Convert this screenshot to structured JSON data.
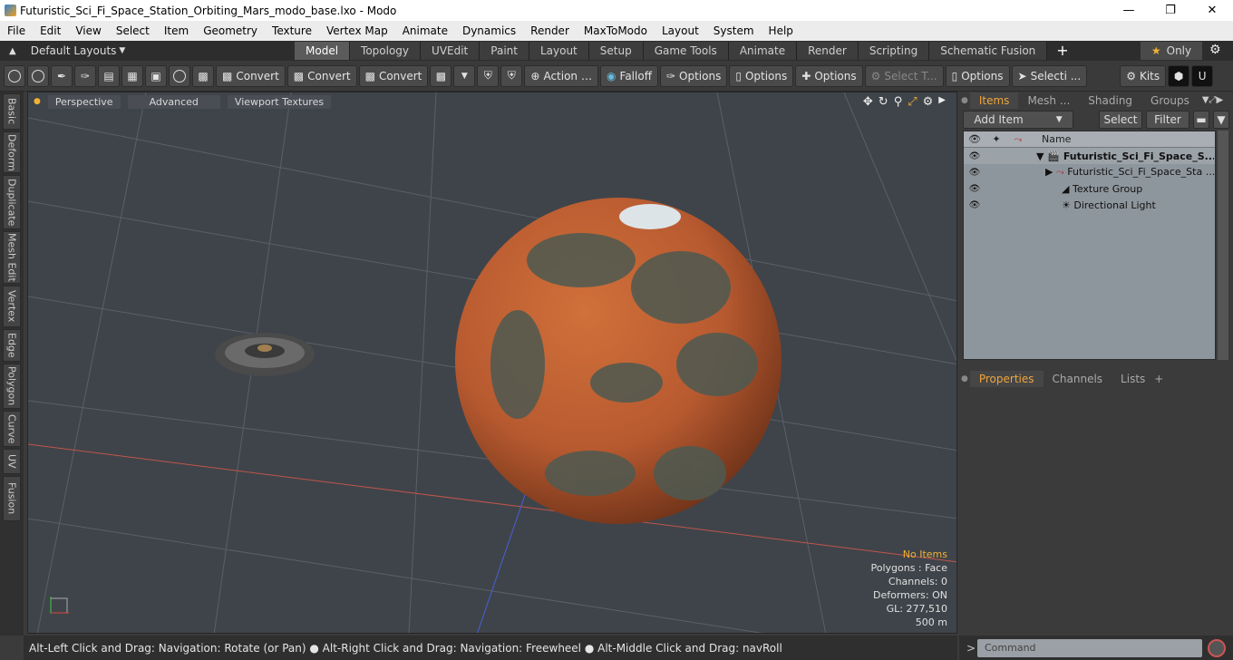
{
  "window": {
    "title": "Futuristic_Sci_Fi_Space_Station_Orbiting_Mars_modo_base.lxo - Modo"
  },
  "menu": [
    "File",
    "Edit",
    "View",
    "Select",
    "Item",
    "Geometry",
    "Texture",
    "Vertex Map",
    "Animate",
    "Dynamics",
    "Render",
    "MaxToModo",
    "Layout",
    "System",
    "Help"
  ],
  "layouts": {
    "label": "Default Layouts"
  },
  "tabs": [
    "Model",
    "Topology",
    "UVEdit",
    "Paint",
    "Layout",
    "Setup",
    "Game Tools",
    "Animate",
    "Render",
    "Scripting",
    "Schematic Fusion"
  ],
  "only_label": "Only",
  "toolbar": {
    "convert1": "Convert",
    "convert2": "Convert",
    "convert3": "Convert",
    "action": "Action",
    "falloff": "Falloff",
    "options1": "Options",
    "options2": "Options",
    "options3": "Options",
    "options4": "Options",
    "select_t": "Select T...",
    "selecti": "Selecti ...",
    "kits": "Kits"
  },
  "left_tabs": [
    "Basic",
    "Deform",
    "Duplicate",
    "Mesh Edit",
    "Vertex",
    "Edge",
    "Polygon",
    "Curve",
    "UV",
    "Fusion"
  ],
  "viewport": {
    "buttons": [
      "Perspective",
      "Advanced",
      "Viewport Textures"
    ],
    "info": {
      "no_items": "No Items",
      "polygons": "Polygons : Face",
      "channels": "Channels: 0",
      "deformers": "Deformers: ON",
      "gl": "GL: 277,510",
      "scale": "500 m"
    }
  },
  "right_panel": {
    "top_tabs": [
      "Items",
      "Mesh ...",
      "Shading",
      "Groups"
    ],
    "add_item": "Add Item",
    "select": "Select",
    "filter": "Filter",
    "col_name": "Name",
    "items": [
      {
        "name": "Futuristic_Sci_Fi_Space_S...",
        "indent": 0
      },
      {
        "name": "Futuristic_Sci_Fi_Space_Sta ...",
        "indent": 1
      },
      {
        "name": "Texture Group",
        "indent": 1
      },
      {
        "name": "Directional Light",
        "indent": 1
      }
    ],
    "bottom_tabs": [
      "Properties",
      "Channels",
      "Lists"
    ]
  },
  "status": {
    "text": "Alt-Left Click and Drag: Navigation: Rotate (or Pan) ● Alt-Right Click and Drag: Navigation: Freewheel ● Alt-Middle Click and Drag: navRoll"
  },
  "command": {
    "placeholder": "Command"
  }
}
